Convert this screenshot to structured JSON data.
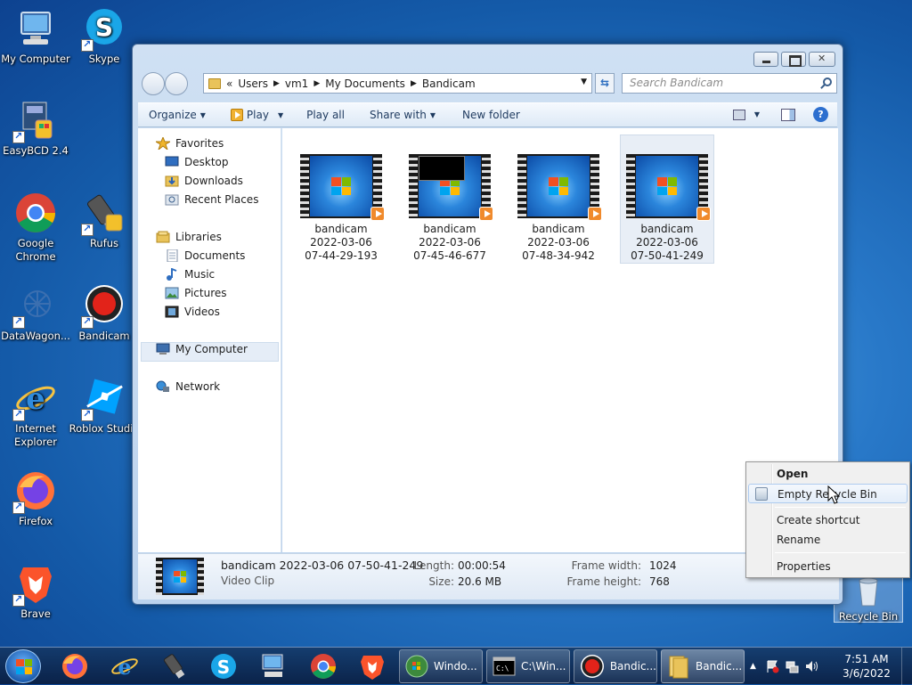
{
  "desktop": {
    "icons": [
      {
        "label": "My Computer"
      },
      {
        "label": "Skype"
      },
      {
        "label": "EasyBCD 2.4"
      },
      {
        "label": "Google Chrome"
      },
      {
        "label": "Rufus"
      },
      {
        "label": "DataWagon..."
      },
      {
        "label": "Bandicam"
      },
      {
        "label": "Internet Explorer"
      },
      {
        "label": "Roblox Studio"
      },
      {
        "label": "Firefox"
      },
      {
        "label": "Brave"
      },
      {
        "label": "Recycle Bin"
      }
    ]
  },
  "explorer": {
    "breadcrumb": [
      "«",
      "Users",
      "vm1",
      "My Documents",
      "Bandicam"
    ],
    "search_placeholder": "Search Bandicam",
    "toolbar": {
      "organize": "Organize",
      "play": "Play",
      "play_all": "Play all",
      "share_with": "Share with",
      "new_folder": "New folder"
    },
    "nav": {
      "favorites": "Favorites",
      "desktop": "Desktop",
      "downloads": "Downloads",
      "recent_places": "Recent Places",
      "libraries": "Libraries",
      "documents": "Documents",
      "music": "Music",
      "pictures": "Pictures",
      "videos": "Videos",
      "my_computer": "My Computer",
      "network": "Network"
    },
    "files": [
      {
        "name": "bandicam",
        "date": "2022-03-06",
        "time": "07-44-29-193"
      },
      {
        "name": "bandicam",
        "date": "2022-03-06",
        "time": "07-45-46-677"
      },
      {
        "name": "bandicam",
        "date": "2022-03-06",
        "time": "07-48-34-942"
      },
      {
        "name": "bandicam",
        "date": "2022-03-06",
        "time": "07-50-41-249"
      }
    ],
    "details": {
      "name": "bandicam 2022-03-06 07-50-41-249",
      "type": "Video Clip",
      "length_label": "Length:",
      "length": "00:00:54",
      "size_label": "Size:",
      "size": "20.6 MB",
      "fw_label": "Frame width:",
      "fw": "1024",
      "fh_label": "Frame height:",
      "fh": "768"
    }
  },
  "context_menu": {
    "open": "Open",
    "empty": "Empty Recycle Bin",
    "shortcut": "Create shortcut",
    "rename": "Rename",
    "properties": "Properties"
  },
  "taskbar": {
    "windows_btn": "Windo...",
    "cmd_btn": "C:\\Win...",
    "bandicam_btn": "Bandic...",
    "explorer_btn": "Bandic...",
    "time": "7:51 AM",
    "date": "3/6/2022"
  }
}
